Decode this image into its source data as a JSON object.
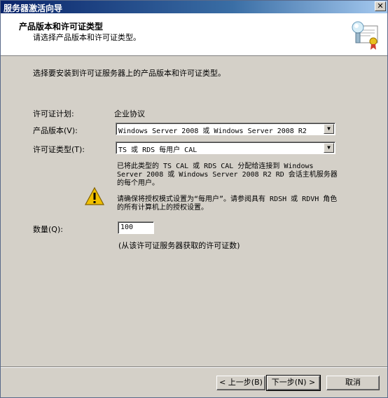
{
  "window": {
    "title": "服务器激活向导",
    "close_label": "✕"
  },
  "header": {
    "title": "产品版本和许可证类型",
    "subtitle": "请选择产品版本和许可证类型。",
    "icon": "certificate-icon"
  },
  "intro": "选择要安装到许可证服务器上的产品版本和许可证类型。",
  "form": {
    "program_label": "许可证计划:",
    "program_value": "企业协议",
    "edition_label": "产品版本(V):",
    "edition_value": "Windows Server 2008 或 Windows Server 2008 R2",
    "type_label": "许可证类型(T):",
    "type_value": "TS 或 RDS 每用户 CAL",
    "type_description": "已将此类型的 TS CAL 或 RDS CAL 分配给连接到 Windows Server 2008 或 Windows Server 2008 R2 RD 会话主机服务器的每个用户。",
    "warning_icon": "warning-icon",
    "warning_text": "请确保将授权模式设置为“每用户”。请参阅具有 RDSH 或 RDVH 角色的所有计算机上的授权设置。",
    "quantity_label": "数量(Q):",
    "quantity_value": "100",
    "quantity_note": "(从该许可证服务器获取的许可证数)"
  },
  "buttons": {
    "back": "< 上一步(B)",
    "next": "下一步(N) >",
    "cancel": "取消"
  }
}
